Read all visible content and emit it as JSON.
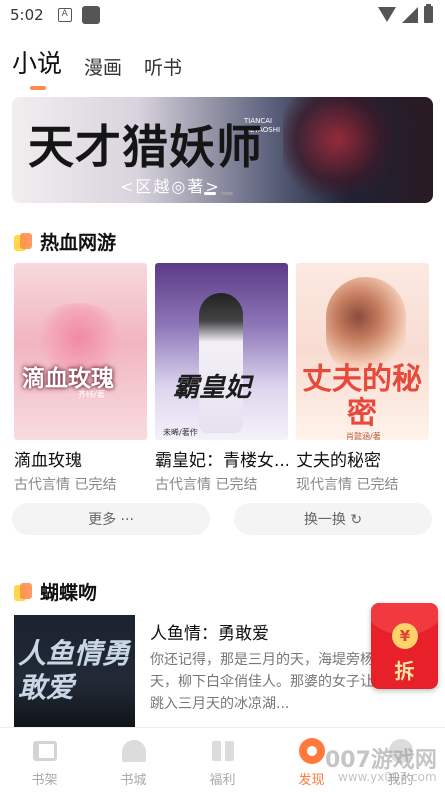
{
  "status_bar": {
    "time": "5:02",
    "app_badge": "A"
  },
  "tabs": [
    {
      "label": "小说",
      "active": true
    },
    {
      "label": "漫画",
      "active": false
    },
    {
      "label": "听书",
      "active": false
    }
  ],
  "banner": {
    "title": "天才猎妖师",
    "author": "<区越◎著>",
    "pinyin_line1": "TIANCAI",
    "pinyin_line2": "LIEYAOSHI",
    "active_slide": 1,
    "slide_count": 2
  },
  "section1": {
    "title": "热血网游",
    "books": [
      {
        "cover_title": "滴血玫瑰",
        "cover_sub": "齐纬/著",
        "name": "滴血玫瑰",
        "meta": "古代言情 已完结"
      },
      {
        "cover_title": "霸皇妃",
        "cover_sub": "未晞/著作",
        "name": "霸皇妃：青楼女...",
        "meta": "古代言情 已完结"
      },
      {
        "cover_title": "丈夫的秘密",
        "cover_sub": "肖懿涵/著",
        "name": "丈夫的秘密",
        "meta": "现代言情 已完结"
      }
    ],
    "more_label": "更多 ···",
    "swap_label": "换一换 ↻"
  },
  "section2": {
    "title": "蝴蝶吻",
    "feature": {
      "cover_title": "人鱼情勇敢爱",
      "title": "人鱼情：勇敢爱",
      "desc": "你还记得，那是三月的天，海堤旁杨柳雾连天，柳下白伞俏佳人。那婆的女子让你宁愿跳入三月天的冰凉湖..."
    }
  },
  "red_packet": {
    "coin": "¥",
    "label": "拆"
  },
  "bottom_nav": [
    {
      "label": "书架",
      "icon": "bookshelf-icon",
      "active": false
    },
    {
      "label": "书城",
      "icon": "bookstore-icon",
      "active": false
    },
    {
      "label": "福利",
      "icon": "gift-icon",
      "active": false
    },
    {
      "label": "发现",
      "icon": "discover-icon",
      "active": true
    },
    {
      "label": "我的",
      "icon": "profile-icon",
      "active": false
    }
  ],
  "watermark": {
    "main": "007游戏网",
    "sub": "www.yx007.com"
  },
  "colors": {
    "accent": "#ff7a3c",
    "red_packet": "#e8202a"
  }
}
